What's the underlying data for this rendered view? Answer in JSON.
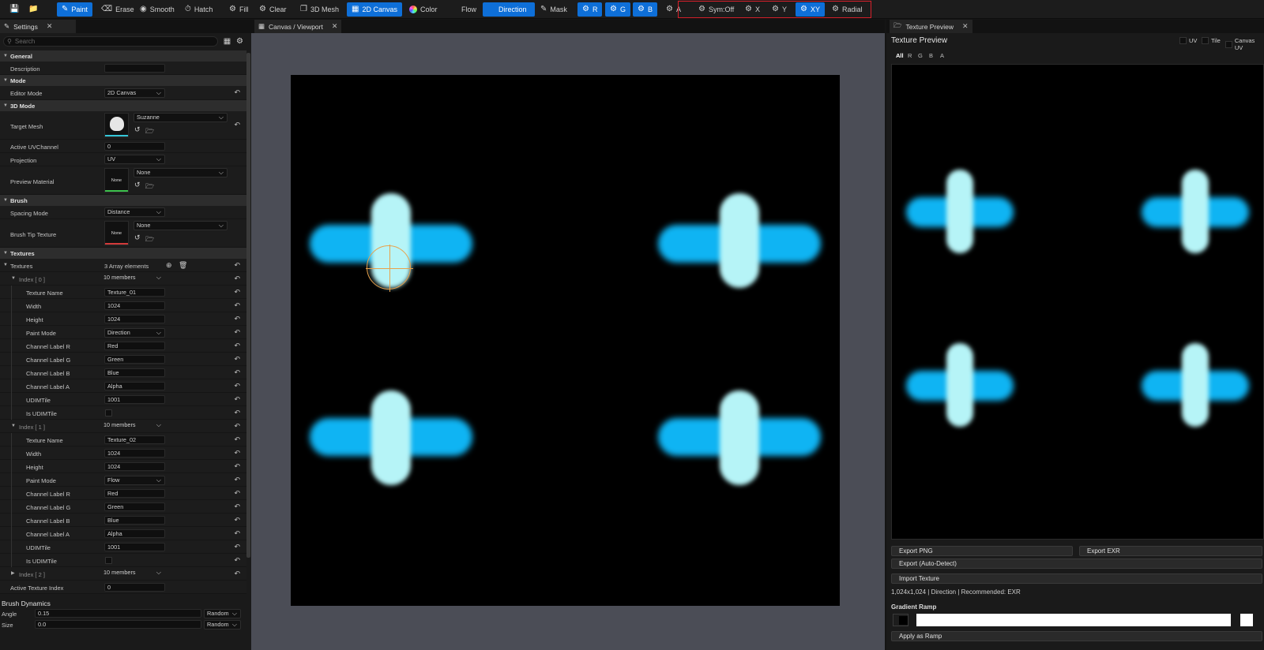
{
  "toolbar": {
    "save_icon": "save-icon",
    "saveas_icon": "save-as-icon",
    "paint": "Paint",
    "erase": "Erase",
    "smooth": "Smooth",
    "hatch": "Hatch",
    "fill": "Fill",
    "clear": "Clear",
    "mesh3d": "3D Mesh",
    "canvas2d": "2D Canvas",
    "color": "Color",
    "flow": "Flow",
    "direction": "Direction",
    "mask": "Mask",
    "r": "R",
    "g": "G",
    "b": "B",
    "a": "A",
    "sym_off": "Sym:Off",
    "x": "X",
    "y": "Y",
    "xy": "XY",
    "radial": "Radial",
    "accent": "#0e6fd8",
    "highlight_box": "#d8202a"
  },
  "settings": {
    "tab": "Settings",
    "search_placeholder": "Search",
    "general": "General",
    "description_label": "Description",
    "description_value": "",
    "mode": "Mode",
    "editor_mode_label": "Editor Mode",
    "editor_mode_value": "2D Canvas",
    "mode3d": "3D Mode",
    "target_mesh_label": "Target Mesh",
    "target_mesh_value": "Suzanne",
    "uv_channel_label": "Active UVChannel",
    "uv_channel_value": "0",
    "projection_label": "Projection",
    "projection_value": "UV",
    "preview_material_label": "Preview Material",
    "preview_material_thumb": "None",
    "preview_material_value": "None",
    "brush": "Brush",
    "spacing_mode_label": "Spacing Mode",
    "spacing_mode_value": "Distance",
    "brush_tip_label": "Brush Tip Texture",
    "brush_tip_thumb": "None",
    "brush_tip_value": "None",
    "textures_section": "Textures",
    "textures_label": "Textures",
    "textures_count": "3 Array elements",
    "index0": {
      "label": "Index [ 0 ]",
      "members": "10 members",
      "texture_name_label": "Texture Name",
      "texture_name": "Texture_01",
      "width_label": "Width",
      "width": "1024",
      "height_label": "Height",
      "height": "1024",
      "paint_mode_label": "Paint Mode",
      "paint_mode": "Direction",
      "ch_r_label": "Channel Label R",
      "ch_r": "Red",
      "ch_g_label": "Channel Label G",
      "ch_g": "Green",
      "ch_b_label": "Channel Label B",
      "ch_b": "Blue",
      "ch_a_label": "Channel Label A",
      "ch_a": "Alpha",
      "udim_label": "UDIMTile",
      "udim": "1001",
      "is_udim_label": "Is UDIMTile"
    },
    "index1": {
      "label": "Index [ 1 ]",
      "members": "10 members",
      "texture_name_label": "Texture Name",
      "texture_name": "Texture_02",
      "width_label": "Width",
      "width": "1024",
      "height_label": "Height",
      "height": "1024",
      "paint_mode_label": "Paint Mode",
      "paint_mode": "Flow",
      "ch_r_label": "Channel Label R",
      "ch_r": "Red",
      "ch_g_label": "Channel Label G",
      "ch_g": "Green",
      "ch_b_label": "Channel Label B",
      "ch_b": "Blue",
      "ch_a_label": "Channel Label A",
      "ch_a": "Alpha",
      "udim_label": "UDIMTile",
      "udim": "1001",
      "is_udim_label": "Is UDIMTile"
    },
    "index2": {
      "label": "Index [ 2 ]",
      "members": "10 members"
    },
    "active_texture_label": "Active Texture Index",
    "active_texture_value": "0",
    "brush_dynamics": "Brush Dynamics",
    "angle_label": "Angle",
    "angle_value": "0.15",
    "angle_mode": "Random",
    "size_label": "Size",
    "size_value": "0.0",
    "size_mode": "Random"
  },
  "viewport": {
    "tab": "Canvas / Viewport",
    "stroke_color": "#0fb4f3",
    "stroke_core_color": "#b6f4f7",
    "cursor_color": "#e8a24c"
  },
  "preview": {
    "tab": "Texture Preview",
    "title": "Texture Preview",
    "uv": "UV",
    "tile": "Tile",
    "canvas_uv": "Canvas UV",
    "ch_all": "All",
    "ch_r": "R",
    "ch_g": "G",
    "ch_b": "B",
    "ch_a": "A",
    "export_png": "Export PNG",
    "export_exr": "Export EXR",
    "export_auto": "Export (Auto-Detect)",
    "import_texture": "Import Texture",
    "info": "1,024x1,024 | Direction | Recommended: EXR",
    "gradient_ramp": "Gradient Ramp",
    "apply_ramp": "Apply as Ramp"
  }
}
